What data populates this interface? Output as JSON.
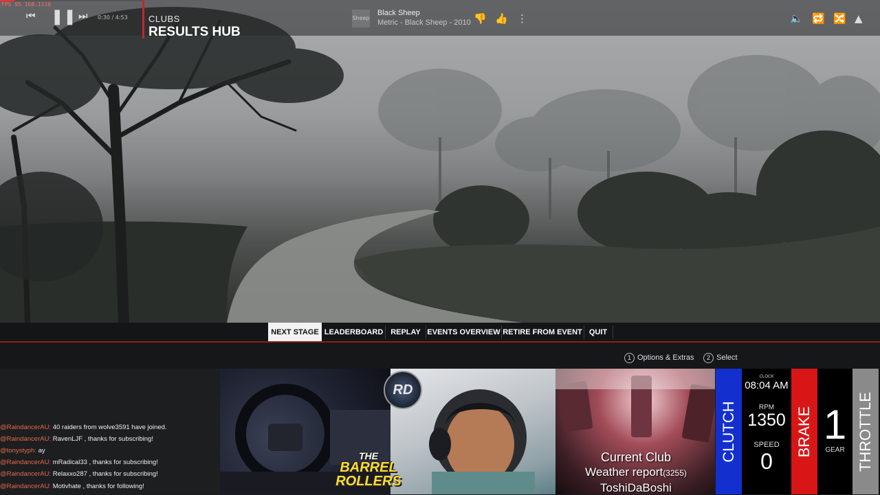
{
  "overlay": {
    "fps_text": "FPS 95   168.1110"
  },
  "player": {
    "time": "0:30 / 4:53",
    "progress": 0.1,
    "thumb_text": "Sheep",
    "song_title": "Black Sheep",
    "song_meta": "Metric - Black Sheep - 2010",
    "icons": [
      "previous-icon",
      "pause-icon",
      "next-icon",
      "thumbs-down-icon",
      "thumbs-up-icon",
      "more-icon",
      "volume-icon",
      "repeat-icon",
      "shuffle-icon",
      "expand-icon"
    ]
  },
  "game": {
    "section": "CLUBS",
    "title": "RESULTS HUB",
    "menu": [
      "NEXT STAGE",
      "LEADERBOARD",
      "REPLAY",
      "EVENTS OVERVIEW",
      "RETIRE FROM EVENT",
      "QUIT"
    ],
    "hints": [
      {
        "key": "1",
        "label": "Options & Extras"
      },
      {
        "key": "2",
        "label": "Select"
      }
    ]
  },
  "chat": [
    {
      "user": "@RaindancerAU:",
      "msg": "40 raiders from wolve3591 have joined."
    },
    {
      "user": "@RaindancerAU:",
      "msg": "RavenLJF , thanks for subscribing!"
    },
    {
      "user": "@tonystyph:",
      "msg": "ay"
    },
    {
      "user": "@RaindancerAU:",
      "msg": "mRadical33 , thanks for subscribing!"
    },
    {
      "user": "@RaindancerAU:",
      "msg": "Relaxxo287 , thanks for subscribing!"
    },
    {
      "user": "@RaindancerAU:",
      "msg": "Motivhate , thanks for following!"
    }
  ],
  "logos": {
    "rd": "RD",
    "barrel_the": "THE",
    "barrel_line1": "BARREL",
    "barrel_line2": "ROLLERS"
  },
  "club_info": {
    "line1": "Current Club",
    "weather": "Weather report",
    "weather_count": "(3255)",
    "user": "ToshiDaBoshi"
  },
  "telemetry": {
    "clutch": "CLUTCH",
    "brake": "BRAKE",
    "throttle": "THROTTLE",
    "clock_label": "CLOCK",
    "clock": "08:04 AM",
    "rpm_label": "RPM",
    "rpm": "1350",
    "speed_label": "SPEED",
    "speed": "0",
    "gear": "1",
    "gear_label": "GEAR"
  },
  "colors": {
    "accent": "#c2272d",
    "clutch": "#1330cf",
    "brake": "#d81616",
    "throttle": "#8a8a8a",
    "chat_user": "#e26b4a"
  }
}
